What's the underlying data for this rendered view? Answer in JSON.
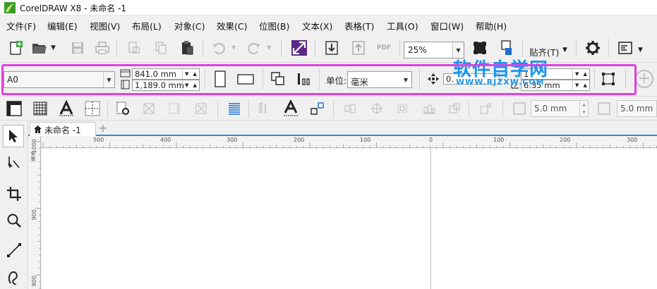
{
  "window": {
    "title": "CorelDRAW X8 - 未命名 -1"
  },
  "menu": [
    {
      "label": "文件(F)"
    },
    {
      "label": "编辑(E)"
    },
    {
      "label": "视图(V)"
    },
    {
      "label": "布局(L)"
    },
    {
      "label": "对象(C)"
    },
    {
      "label": "效果(C)"
    },
    {
      "label": "位图(B)"
    },
    {
      "label": "文本(X)"
    },
    {
      "label": "表格(T)"
    },
    {
      "label": "工具(O)"
    },
    {
      "label": "窗口(W)"
    },
    {
      "label": "帮助(H)"
    }
  ],
  "toolbar": {
    "zoom_value": "25%",
    "snap_label": "贴齐(T)",
    "pdf_label": "PDF"
  },
  "property_bar": {
    "paper_size": "A0",
    "page_width": "841.0 mm",
    "page_height": "1,189.0 mm",
    "unit_label": "单位:",
    "unit_value": "毫米",
    "nudge_value": "0.",
    "dup_x": "1",
    "dup_y": "6.35 mm"
  },
  "toolbar3": {
    "field1": "5.0 mm",
    "field2": "5.0 mm"
  },
  "watermark": {
    "text": "软件自学网",
    "url": "WWW.RJZXW.COM"
  },
  "document": {
    "tab_label": "未命名 -1"
  },
  "rulers": {
    "h_labels": [
      "500",
      "400",
      "300",
      "200",
      "100",
      "0",
      "100",
      "200",
      "300"
    ],
    "v_labels": [
      "1000",
      "900",
      "800"
    ],
    "v_unit": "毫米"
  },
  "colors": {
    "highlight": "#e040e0",
    "watermark": "#1696ee",
    "tab_accent": "#2a8fd8"
  }
}
